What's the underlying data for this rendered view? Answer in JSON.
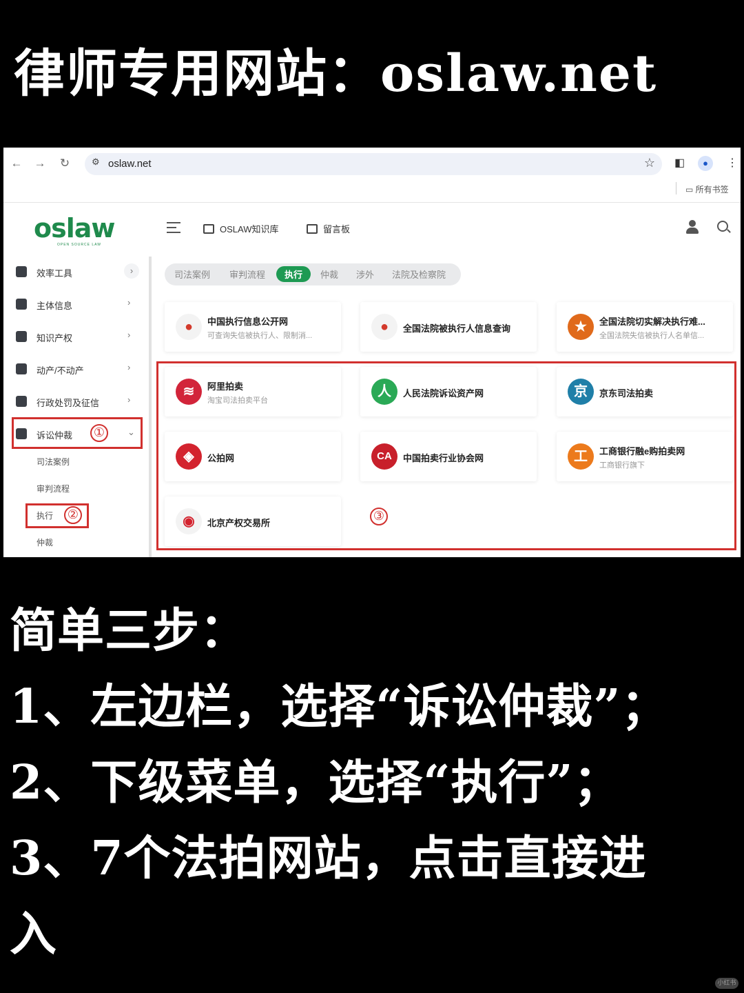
{
  "headline": "律师专用网站：oslaw.net",
  "browser": {
    "url": "oslaw.net",
    "bookmarks_label": "所有书签"
  },
  "app": {
    "logo_text": "oslaw",
    "logo_tagline": "OPEN SOURCE LAW",
    "top_links": [
      "OSLAW知识库",
      "留言板"
    ]
  },
  "sidebar": {
    "items": [
      "效率工具",
      "主体信息",
      "知识产权",
      "动产/不动产",
      "行政处罚及征信",
      "诉讼仲裁"
    ],
    "sub_items": [
      "司法案例",
      "审判流程",
      "执行",
      "仲裁"
    ]
  },
  "tabs": [
    "司法案例",
    "审判流程",
    "执行",
    "仲裁",
    "涉外",
    "法院及检察院"
  ],
  "active_tab": "执行",
  "cards": [
    {
      "name": "中国执行信息公开网",
      "desc": "可查询失信被执行人、限制消...",
      "icon": "court-emblem",
      "color": "#d33a2c"
    },
    {
      "name": "全国法院被执行人信息查询",
      "desc": "",
      "icon": "court-emblem",
      "color": "#d33a2c"
    },
    {
      "name": "全国法院切实解决执行难...",
      "desc": "全国法院失信被执行人名单信...",
      "icon": "court-emblem",
      "color": "#e06a1b"
    },
    {
      "name": "阿里拍卖",
      "desc": "淘宝司法拍卖平台",
      "icon": "ali-auction",
      "color": "#d2243a"
    },
    {
      "name": "人民法院诉讼资产网",
      "desc": "",
      "icon": "person-glyph",
      "color": "#2aa956",
      "glyph": "人"
    },
    {
      "name": "京东司法拍卖",
      "desc": "",
      "icon": "jd-glyph",
      "color": "#1f7fa8",
      "glyph": "京"
    },
    {
      "name": "公拍网",
      "desc": "",
      "icon": "gongpai",
      "color": "#d3232e"
    },
    {
      "name": "中国拍卖行业协会网",
      "desc": "",
      "icon": "cah",
      "color": "#c8202b"
    },
    {
      "name": "工商银行融e购拍卖网",
      "desc": "工商银行旗下",
      "icon": "icbc-glyph",
      "color": "#ec7a1c",
      "glyph": "工"
    },
    {
      "name": "北京产权交易所",
      "desc": "",
      "icon": "cbex",
      "color": "#d3232e"
    }
  ],
  "annotations": [
    "①",
    "②",
    "③"
  ],
  "steps": [
    "简单三步：",
    "1、左边栏，选择“诉讼仲裁”；",
    "2、下级菜单，选择“执行”；",
    "3、7个法拍网站，点击直接进",
    "入"
  ],
  "watermark": "小红书"
}
